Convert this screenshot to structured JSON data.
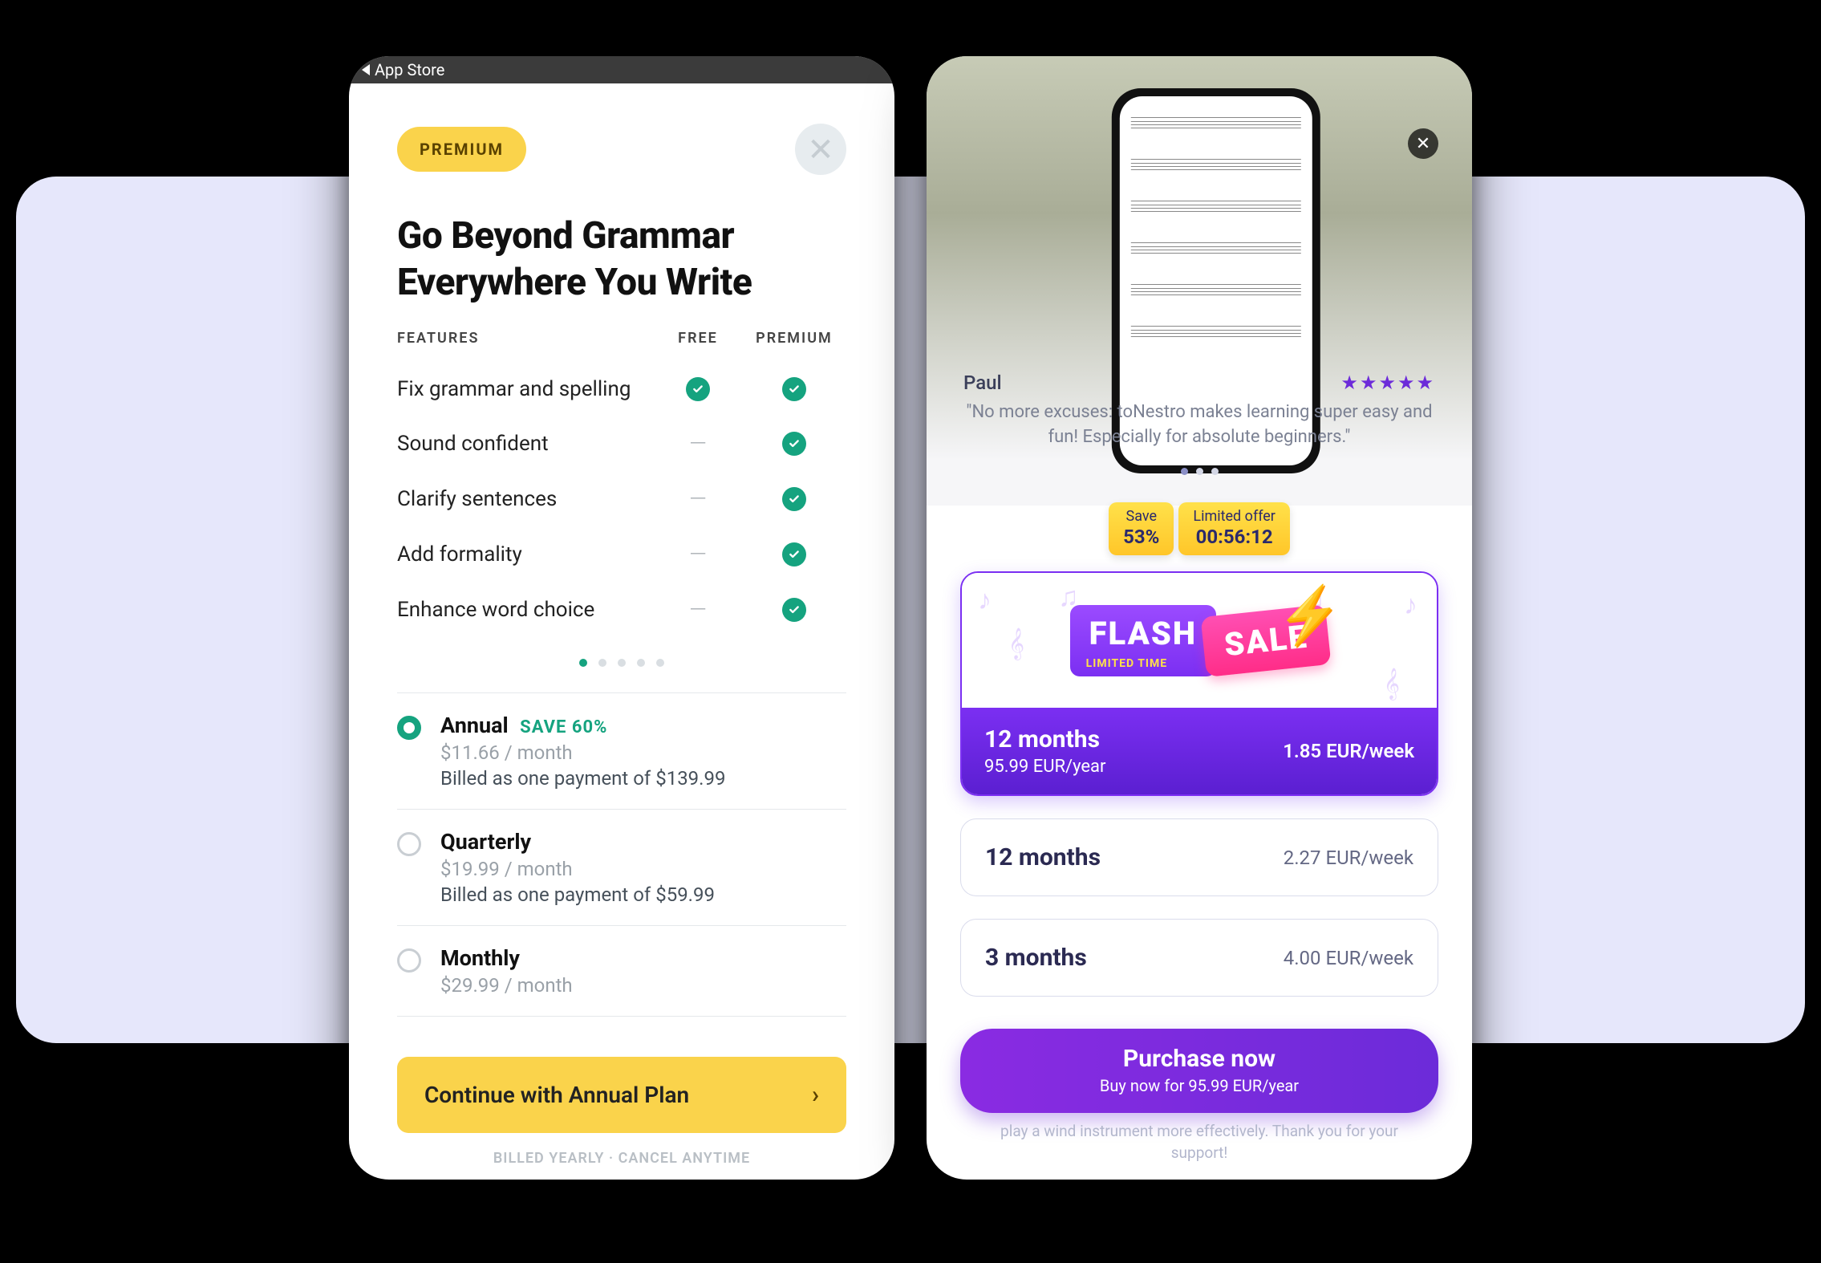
{
  "left": {
    "statusbar": {
      "back_label": "App Store"
    },
    "premium_badge": "PREMIUM",
    "title": "Go Beyond Grammar Everywhere You Write",
    "columns": {
      "features": "FEATURES",
      "free": "FREE",
      "premium": "PREMIUM"
    },
    "features": [
      {
        "label": "Fix grammar and spelling",
        "free": true,
        "premium": true
      },
      {
        "label": "Sound confident",
        "free": false,
        "premium": true
      },
      {
        "label": "Clarify sentences",
        "free": false,
        "premium": true
      },
      {
        "label": "Add formality",
        "free": false,
        "premium": true
      },
      {
        "label": "Enhance word choice",
        "free": false,
        "premium": true
      }
    ],
    "pager": {
      "count": 5,
      "active": 0
    },
    "plans": [
      {
        "name": "Annual",
        "save": "SAVE 60%",
        "price": "$11.66 / month",
        "billing": "Billed as one payment of $139.99",
        "selected": true
      },
      {
        "name": "Quarterly",
        "save": "",
        "price": "$19.99 / month",
        "billing": "Billed as one payment of $59.99",
        "selected": false
      },
      {
        "name": "Monthly",
        "save": "",
        "price": "$29.99 / month",
        "billing": "",
        "selected": false
      }
    ],
    "cta": "Continue with Annual Plan",
    "footnote": "BILLED YEARLY · CANCEL ANYTIME"
  },
  "right": {
    "review": {
      "name": "Paul",
      "stars": "★★★★★",
      "quote": "\"No more excuses: toNestro makes learning super easy and fun! Especially for absolute beginners.\""
    },
    "pager": {
      "count": 3,
      "active": 0
    },
    "save_tag": {
      "label": "Save",
      "value": "53%"
    },
    "timer_tag": {
      "label": "Limited offer",
      "value": "00:56:12"
    },
    "flash": {
      "word1": "FLASH",
      "limited": "LIMITED TIME",
      "word2": "SALE"
    },
    "featured_plan": {
      "name": "12 months",
      "sub": "95.99 EUR/year",
      "rate": "1.85 EUR/week"
    },
    "plans": [
      {
        "name": "12 months",
        "rate": "2.27 EUR/week"
      },
      {
        "name": "3 months",
        "rate": "4.00 EUR/week"
      }
    ],
    "cta": {
      "title": "Purchase now",
      "sub": "Buy now for 95.99 EUR/year"
    },
    "footnote": "play a wind instrument more effectively. Thank you for your support!"
  }
}
